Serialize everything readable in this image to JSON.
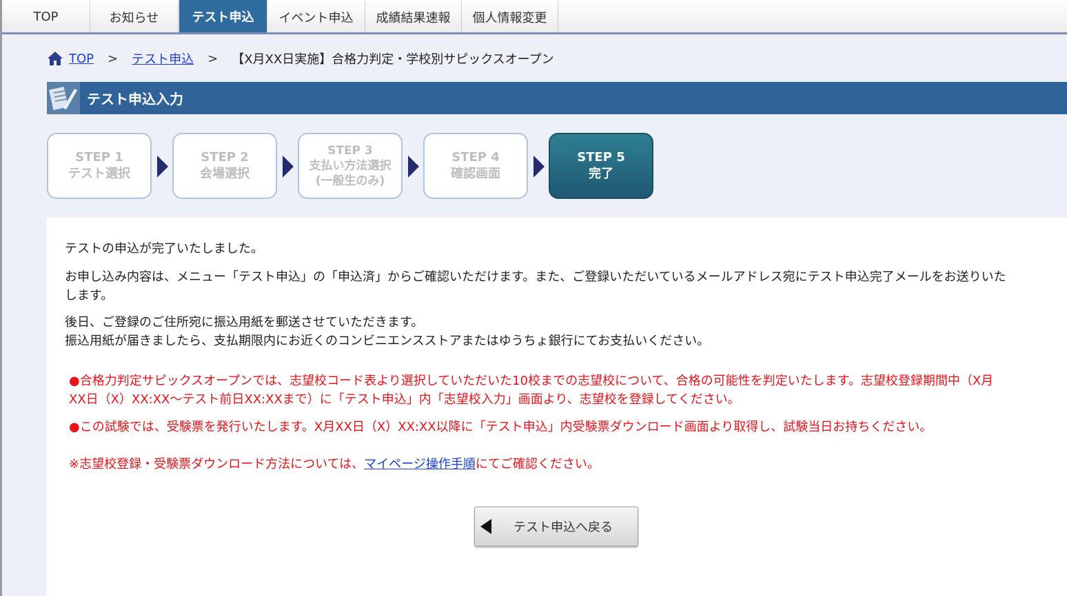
{
  "nav": {
    "tabs": [
      {
        "label": "TOP"
      },
      {
        "label": "お知らせ"
      },
      {
        "label": "テスト申込"
      },
      {
        "label": "イベント申込"
      },
      {
        "label": "成績結果速報"
      },
      {
        "label": "個人情報変更"
      }
    ],
    "active_index": 2
  },
  "breadcrumb": {
    "top": "TOP",
    "sep": ">",
    "test": "テスト申込",
    "current": "【X月XX日実施】合格力判定・学校別サピックスオープン"
  },
  "section": {
    "title": "テスト申込入力"
  },
  "steps": [
    {
      "num": "STEP 1",
      "label": "テスト選択"
    },
    {
      "num": "STEP 2",
      "label": "会場選択"
    },
    {
      "num": "STEP 3",
      "label": "支払い方法選択",
      "sub": "(一般生のみ)"
    },
    {
      "num": "STEP 4",
      "label": "確認画面"
    },
    {
      "num": "STEP 5",
      "label": "完了"
    }
  ],
  "content": {
    "line1": "テストの申込が完了いたしました。",
    "line2a": "お申し込み内容は、メニュー「テスト申込」の「申込済」からご確認いただけます。また、ご登録いただいているメールアドレス宛にテスト申込完了メールをお送りいた",
    "line2b": "します。",
    "line3a": "後日、ご登録のご住所宛に振込用紙を郵送させていただきます。",
    "line3b": "振込用紙が届きましたら、支払期限内にお近くのコンビニエンスストアまたはゆうちょ銀行にてお支払いください。",
    "notice1a": "●合格力判定サピックスオープンでは、志望校コード表より選択していただいた10校までの志望校について、合格の可能性を判定いたします。志望校登録期間中（X月",
    "notice1b": "XX日（X）XX:XX～テスト前日XX:XXまで）に「テスト申込」内「志望校入力」画面より、志望校を登録してください。",
    "notice2": "●この試験では、受験票を発行いたします。X月XX日（X）XX:XX以降に「テスト申込」内受験票ダウンロード画面より取得し、試験当日お持ちください。",
    "note_pre": "※志望校登録・受験票ダウンロード方法については、",
    "note_link": "マイページ操作手順",
    "note_post": "にてご確認ください。"
  },
  "back_button": {
    "label": "テスト申込へ戻る"
  },
  "colors": {
    "accent": "#2f6399",
    "notice": "#e8141a",
    "link": "#1b3fd6"
  }
}
